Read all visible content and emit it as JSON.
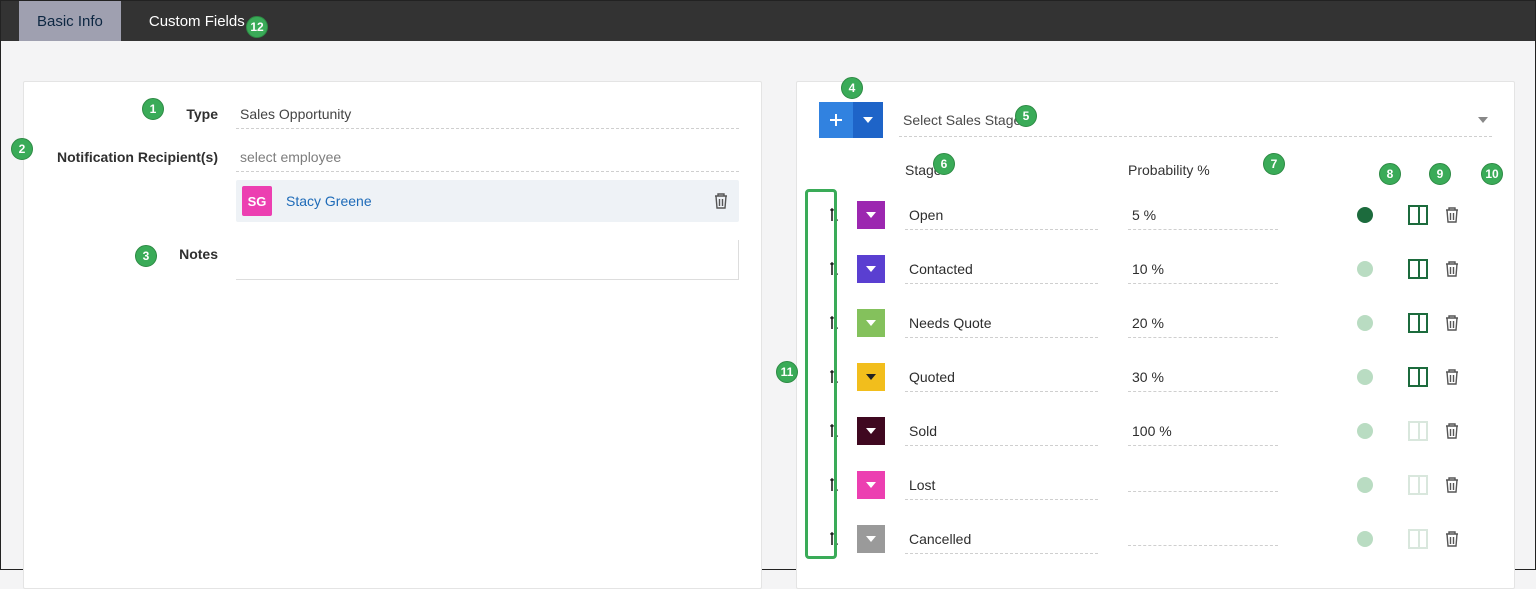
{
  "tabs": {
    "basic_info": "Basic Info",
    "custom_fields": "Custom Fields"
  },
  "left": {
    "type_label": "Type",
    "type_value": "Sales Opportunity",
    "recipients_label": "Notification Recipient(s)",
    "recipients_placeholder": "select employee",
    "recipient": {
      "initials": "SG",
      "name": "Stacy Greene"
    },
    "notes_label": "Notes"
  },
  "right": {
    "select_stage_label": "Select Sales Stage",
    "columns": {
      "stage": "Stage",
      "probability": "Probability %"
    },
    "rows": [
      {
        "name": "Open",
        "prob": "5 %",
        "color": "#9c27b0",
        "caret": "#ffffff",
        "dot": "#1c6b3d",
        "board_on": true,
        "board_color": "#1c6b3d"
      },
      {
        "name": "Contacted",
        "prob": "10 %",
        "color": "#5a3fd1",
        "caret": "#ffffff",
        "dot": "#b9dcc2",
        "board_on": true,
        "board_color": "#1c6b3d"
      },
      {
        "name": "Needs Quote",
        "prob": "20 %",
        "color": "#84c15c",
        "caret": "#ffffff",
        "dot": "#b9dcc2",
        "board_on": true,
        "board_color": "#1c6b3d"
      },
      {
        "name": "Quoted",
        "prob": "30 %",
        "color": "#f2be1c",
        "caret": "#222222",
        "dot": "#b9dcc2",
        "board_on": true,
        "board_color": "#1c6b3d"
      },
      {
        "name": "Sold",
        "prob": "100 %",
        "color": "#3f0820",
        "caret": "#ffffff",
        "dot": "#b9dcc2",
        "board_on": false,
        "board_color": "#d9e7dd"
      },
      {
        "name": "Lost",
        "prob": "",
        "color": "#ec3fb1",
        "caret": "#ffffff",
        "dot": "#b9dcc2",
        "board_on": false,
        "board_color": "#d9e7dd"
      },
      {
        "name": "Cancelled",
        "prob": "",
        "color": "#9a9a9a",
        "caret": "#ffffff",
        "dot": "#b9dcc2",
        "board_on": false,
        "board_color": "#d9e7dd"
      }
    ]
  },
  "annotations": {
    "1": "1",
    "2": "2",
    "3": "3",
    "4": "4",
    "5": "5",
    "6": "6",
    "7": "7",
    "8": "8",
    "9": "9",
    "10": "10",
    "11": "11",
    "12": "12"
  }
}
